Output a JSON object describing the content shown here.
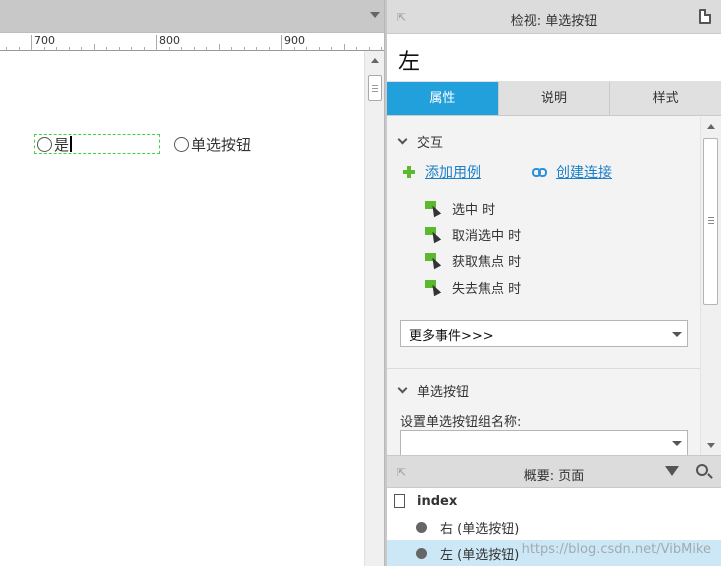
{
  "canvas": {
    "ruler_labels": [
      "700",
      "800",
      "900"
    ],
    "radio_selected_label": "是",
    "radio_second_label": "单选按钮"
  },
  "inspector": {
    "title": "检视: 单选按钮",
    "widget_name": "左",
    "tabs": [
      {
        "label": "属性",
        "active": true
      },
      {
        "label": "说明",
        "active": false
      },
      {
        "label": "样式",
        "active": false
      }
    ],
    "interaction_section": "交互",
    "add_case_label": "添加用例",
    "create_link_label": "创建连接",
    "events": [
      "选中 时",
      "取消选中 时",
      "获取焦点 时",
      "失去焦点 时"
    ],
    "more_events_label": "更多事件>>>",
    "radio_section": "单选按钮",
    "group_name_label": "设置单选按钮组名称:",
    "group_name_value": ""
  },
  "outline": {
    "title": "概要: 页面",
    "root": "index",
    "items": [
      {
        "label": "右 (单选按钮)",
        "selected": false
      },
      {
        "label": "左 (单选按钮)",
        "selected": true
      }
    ]
  },
  "watermark": "https://blog.csdn.net/VibMike",
  "colors": {
    "active_tab": "#22a0db",
    "link": "#1c7fc7",
    "add_icon": "#5cb82e",
    "selection_outline": "#43d343",
    "tree_selected": "#cce8f7"
  }
}
